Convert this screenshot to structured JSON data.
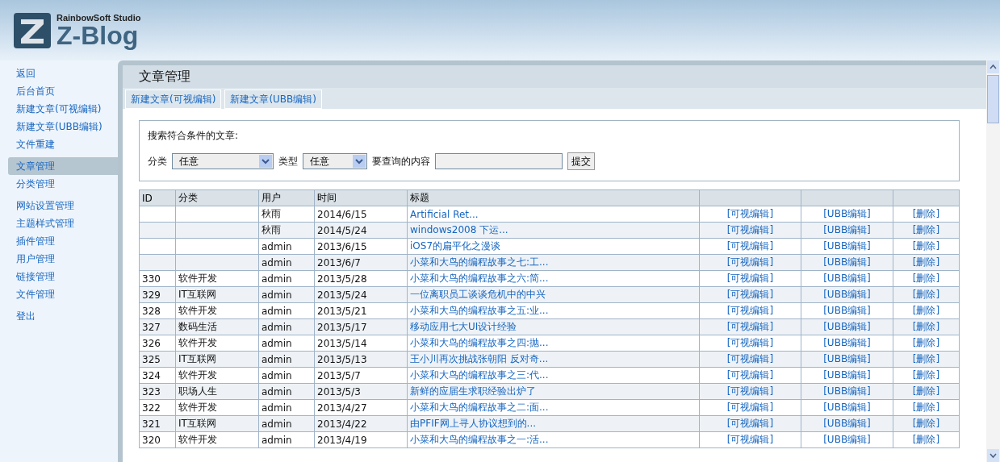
{
  "logo": {
    "brand": "RainbowSoft Studio",
    "name": "Z-Blog"
  },
  "sidebar": {
    "groups": [
      {
        "items": [
          {
            "label": "返回",
            "selected": false
          },
          {
            "label": "后台首页",
            "selected": false
          },
          {
            "label": "新建文章(可视编辑)",
            "selected": false
          },
          {
            "label": "新建文章(UBB编辑)",
            "selected": false
          },
          {
            "label": "文件重建",
            "selected": false
          }
        ]
      },
      {
        "items": [
          {
            "label": "文章管理",
            "selected": true
          },
          {
            "label": "分类管理",
            "selected": false
          }
        ]
      },
      {
        "items": [
          {
            "label": "网站设置管理",
            "selected": false
          },
          {
            "label": "主题样式管理",
            "selected": false
          },
          {
            "label": "插件管理",
            "selected": false
          },
          {
            "label": "用户管理",
            "selected": false
          },
          {
            "label": "链接管理",
            "selected": false
          },
          {
            "label": "文件管理",
            "selected": false
          }
        ]
      },
      {
        "items": [
          {
            "label": "登出",
            "selected": false
          }
        ]
      }
    ]
  },
  "panel": {
    "title": "文章管理",
    "tabs": [
      {
        "label": "新建文章(可视编辑)"
      },
      {
        "label": "新建文章(UBB编辑)"
      }
    ]
  },
  "search": {
    "heading": "搜索符合条件的文章:",
    "category_label": "分类",
    "category_value": "任意",
    "type_label": "类型",
    "type_value": "任意",
    "query_label": "要查询的内容",
    "submit": "提交"
  },
  "table": {
    "columns": [
      "ID",
      "分类",
      "用户",
      "时间",
      "标题"
    ],
    "rows": [
      {
        "user": "秋雨",
        "time": "2014/6/15",
        "title": "Artificial Ret...",
        "edit": "[可视编辑]",
        "ubb": "[UBB编辑]",
        "delete": "[删除]"
      },
      {
        "user": "秋雨",
        "time": "2014/5/24",
        "title": "windows2008 下运...",
        "edit": "[可视编辑]",
        "ubb": "[UBB编辑]",
        "delete": "[删除]"
      },
      {
        "user": "admin",
        "time": "2013/6/15",
        "title": "iOS7的扁平化之漫谈",
        "edit": "[可视编辑]",
        "ubb": "[UBB编辑]",
        "delete": "[删除]"
      },
      {
        "user": "admin",
        "time": "2013/6/7",
        "title": "小菜和大鸟的编程故事之七:工...",
        "edit": "[可视编辑]",
        "ubb": "[UBB编辑]",
        "delete": "[删除]"
      },
      {
        "id": "330",
        "category": "软件开发",
        "user": "admin",
        "time": "2013/5/28",
        "title": "小菜和大鸟的编程故事之六:简...",
        "edit": "[可视编辑]",
        "ubb": "[UBB编辑]",
        "delete": "[删除]"
      },
      {
        "id": "329",
        "category": "IT互联网",
        "user": "admin",
        "time": "2013/5/24",
        "title": "一位离职员工谈谈危机中的中兴",
        "edit": "[可视编辑]",
        "ubb": "[UBB编辑]",
        "delete": "[删除]"
      },
      {
        "id": "328",
        "category": "软件开发",
        "user": "admin",
        "time": "2013/5/21",
        "title": "小菜和大鸟的编程故事之五:业...",
        "edit": "[可视编辑]",
        "ubb": "[UBB编辑]",
        "delete": "[删除]"
      },
      {
        "id": "327",
        "category": "数码生活",
        "user": "admin",
        "time": "2013/5/17",
        "title": "移动应用七大UI设计经验",
        "edit": "[可视编辑]",
        "ubb": "[UBB编辑]",
        "delete": "[删除]"
      },
      {
        "id": "326",
        "category": "软件开发",
        "user": "admin",
        "time": "2013/5/14",
        "title": "小菜和大鸟的编程故事之四:抛...",
        "edit": "[可视编辑]",
        "ubb": "[UBB编辑]",
        "delete": "[删除]"
      },
      {
        "id": "325",
        "category": "IT互联网",
        "user": "admin",
        "time": "2013/5/13",
        "title": "王小川再次挑战张朝阳 反对奇...",
        "edit": "[可视编辑]",
        "ubb": "[UBB编辑]",
        "delete": "[删除]"
      },
      {
        "id": "324",
        "category": "软件开发",
        "user": "admin",
        "time": "2013/5/7",
        "title": "小菜和大鸟的编程故事之三:代...",
        "edit": "[可视编辑]",
        "ubb": "[UBB编辑]",
        "delete": "[删除]"
      },
      {
        "id": "323",
        "category": "职场人生",
        "user": "admin",
        "time": "2013/5/3",
        "title": "新鲜的应届生求职经验出炉了",
        "edit": "[可视编辑]",
        "ubb": "[UBB编辑]",
        "delete": "[删除]"
      },
      {
        "id": "322",
        "category": "软件开发",
        "user": "admin",
        "time": "2013/4/27",
        "title": "小菜和大鸟的编程故事之二:面...",
        "edit": "[可视编辑]",
        "ubb": "[UBB编辑]",
        "delete": "[删除]"
      },
      {
        "id": "321",
        "category": "IT互联网",
        "user": "admin",
        "time": "2013/4/22",
        "title": "由PFIF网上寻人协议想到的...",
        "edit": "[可视编辑]",
        "ubb": "[UBB编辑]",
        "delete": "[删除]"
      },
      {
        "id": "320",
        "category": "软件开发",
        "user": "admin",
        "time": "2013/4/19",
        "title": "小菜和大鸟的编程故事之一:活...",
        "edit": "[可视编辑]",
        "ubb": "[UBB编辑]",
        "delete": "[删除]"
      }
    ]
  }
}
